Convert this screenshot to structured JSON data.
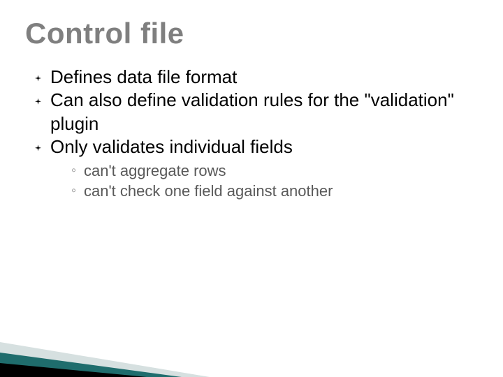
{
  "title": "Control file",
  "bullets": [
    {
      "text": "Defines data file format"
    },
    {
      "text": "Can also define validation rules for the \"validation\" plugin"
    },
    {
      "text": "Only validates individual fields",
      "sub": [
        "can't aggregate rows",
        "can't check one field against another"
      ]
    }
  ]
}
